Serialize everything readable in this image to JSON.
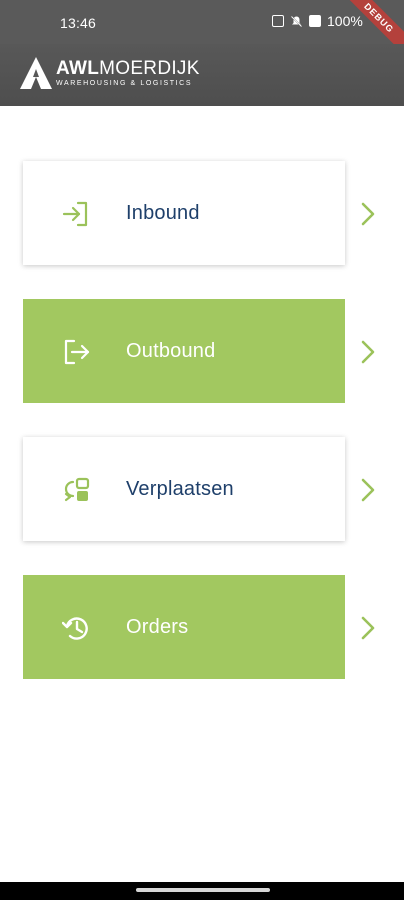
{
  "status_bar": {
    "time": "13:46",
    "battery": "100%",
    "icons": [
      "nfc-icon",
      "mute-icon",
      "vibrate-icon",
      "battery-icon"
    ]
  },
  "debug_banner": "DEBUG",
  "header": {
    "brand_awl": "AWL",
    "brand_rest": "MOERDIJK",
    "tagline": "WAREHOUSING & LOGISTICS"
  },
  "menu": [
    {
      "label": "Inbound",
      "icon": "login-icon",
      "style": "white"
    },
    {
      "label": "Outbound",
      "icon": "logout-icon",
      "style": "green"
    },
    {
      "label": "Verplaatsen",
      "icon": "move-swap-icon",
      "style": "white"
    },
    {
      "label": "Orders",
      "icon": "history-icon",
      "style": "green"
    }
  ],
  "colors": {
    "accent_green": "#a2c860",
    "label_navy": "#1e3f6a",
    "header_gray": "#585858"
  }
}
